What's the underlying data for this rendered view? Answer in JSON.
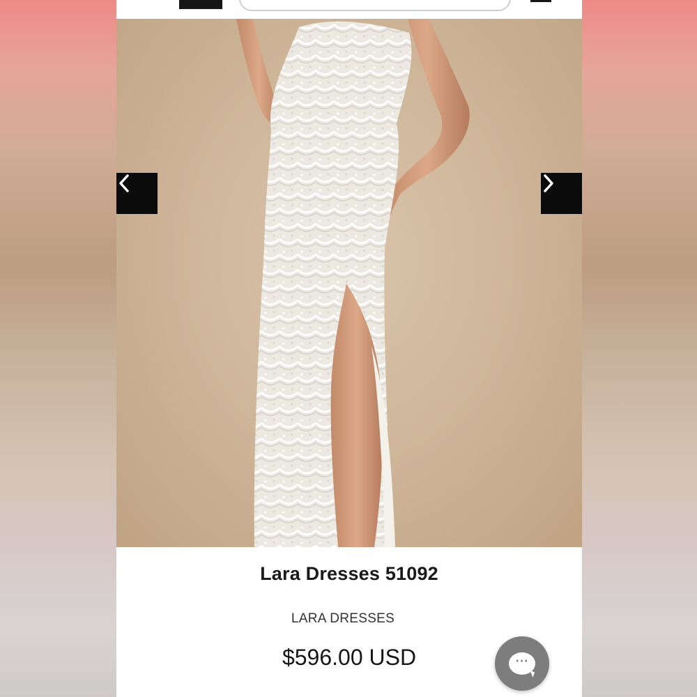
{
  "product": {
    "title": "Lara Dresses 51092",
    "brand": "LARA DRESSES",
    "price": "$596.00 USD"
  },
  "gallery": {
    "prev_icon": "chevron-left-icon",
    "next_icon": "chevron-right-icon"
  },
  "chat": {
    "icon": "chat-bubble-icon",
    "dots": "···"
  },
  "colors": {
    "accent_dark": "#0b0b0b",
    "chat_button": "#7d7d7d",
    "backdrop": "#cdb497"
  }
}
